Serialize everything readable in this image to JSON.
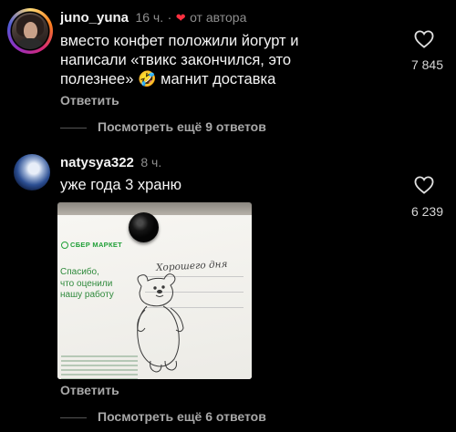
{
  "comments": [
    {
      "username": "juno_yuna",
      "time": "16 ч.",
      "separator": "·",
      "liked_by_author_label": "от автора",
      "text": "вместо конфет положили йогурт и написали «твикс закончился, это полезнее» 🤣 магнит доставка",
      "likes": "7 845",
      "reply_label": "Ответить",
      "view_more_label": "Посмотреть ещё 9 ответов"
    },
    {
      "username": "natysya322",
      "time": "8 ч.",
      "text": "уже года 3 храню",
      "likes": "6 239",
      "reply_label": "Ответить",
      "view_more_label": "Посмотреть ещё 6 ответов",
      "photo": {
        "brand": "СБЕР МАРКЕТ",
        "thanks_lines": [
          "Спасибо,",
          "что оценили",
          "нашу работу"
        ],
        "handwritten": "Хорошего дня"
      }
    }
  ],
  "colors": {
    "background": "#000000",
    "text": "#f5f5f5",
    "muted": "#8e8e8e",
    "heart_red": "#ff3040",
    "brand_green": "#21a038"
  },
  "icons": {
    "like": "heart-outline-icon",
    "author_like": "heart-filled-icon",
    "avatar_1": "avatar-photo",
    "avatar_2": "avatar-photo"
  }
}
